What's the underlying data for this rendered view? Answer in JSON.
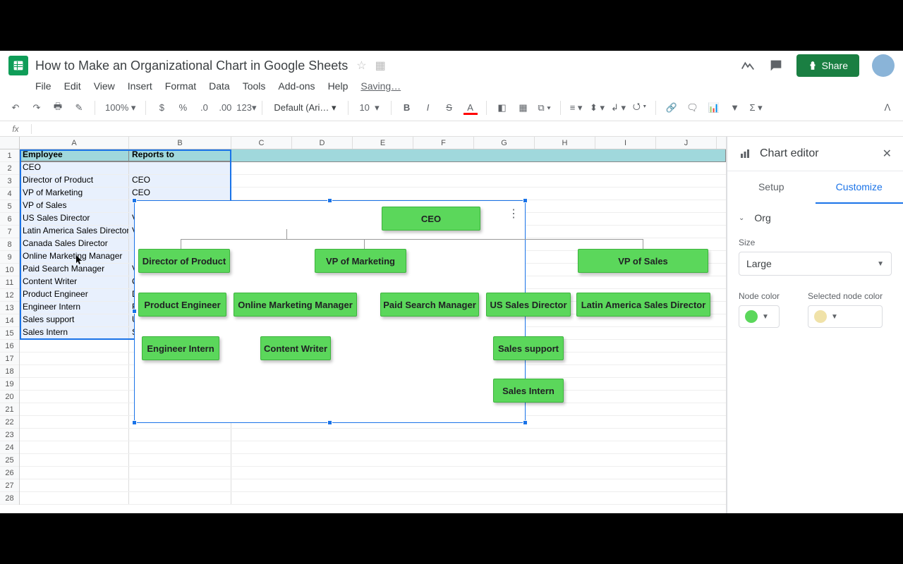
{
  "doc": {
    "title": "How to Make an Organizational Chart in Google Sheets",
    "saving": "Saving…"
  },
  "menus": [
    "File",
    "Edit",
    "View",
    "Insert",
    "Format",
    "Data",
    "Tools",
    "Add-ons",
    "Help"
  ],
  "share": "Share",
  "toolbar": {
    "zoom": "100%",
    "font": "Default (Ari…",
    "size": "10",
    "fmt123": "123"
  },
  "columns": [
    "A",
    "B",
    "C",
    "D",
    "E",
    "F",
    "G",
    "H",
    "I",
    "J"
  ],
  "rowcount": 28,
  "headers": {
    "a": "Employee",
    "b": "Reports to"
  },
  "rows": [
    {
      "a": "CEO",
      "b": ""
    },
    {
      "a": "Director of Product",
      "b": "CEO"
    },
    {
      "a": "VP of Marketing",
      "b": "CEO"
    },
    {
      "a": "VP of Sales",
      "b": ""
    },
    {
      "a": "US Sales Director",
      "b": "V"
    },
    {
      "a": "Latin America Sales Director",
      "b": "V"
    },
    {
      "a": "Canada Sales Director",
      "b": ""
    },
    {
      "a": "Online Marketing Manager",
      "b": ""
    },
    {
      "a": "Paid Search Manager",
      "b": "V"
    },
    {
      "a": "Content Writer",
      "b": "C"
    },
    {
      "a": "Product Engineer",
      "b": "D"
    },
    {
      "a": "Engineer Intern",
      "b": "F"
    },
    {
      "a": "Sales support",
      "b": "U"
    },
    {
      "a": "Sales Intern",
      "b": "S"
    }
  ],
  "chart_data": {
    "type": "org",
    "nodes": [
      {
        "id": "CEO",
        "label": "CEO",
        "parent": null
      },
      {
        "id": "Director of Product",
        "label": "Director of Product",
        "parent": "CEO"
      },
      {
        "id": "VP of Marketing",
        "label": "VP of Marketing",
        "parent": "CEO"
      },
      {
        "id": "VP of Sales",
        "label": "VP of Sales",
        "parent": "CEO"
      },
      {
        "id": "Product Engineer",
        "label": "Product Engineer",
        "parent": "Director of Product"
      },
      {
        "id": "Online Marketing Manager",
        "label": "Online Marketing Manager",
        "parent": "VP of Marketing"
      },
      {
        "id": "Paid Search Manager",
        "label": "Paid Search Manager",
        "parent": "VP of Marketing"
      },
      {
        "id": "US Sales Director",
        "label": "US Sales Director",
        "parent": "VP of Sales"
      },
      {
        "id": "Latin America Sales Director",
        "label": "Latin America Sales Director",
        "parent": "VP of Sales"
      },
      {
        "id": "Engineer Intern",
        "label": "Engineer Intern",
        "parent": "Product Engineer"
      },
      {
        "id": "Content Writer",
        "label": "Content Writer",
        "parent": "Online Marketing Manager"
      },
      {
        "id": "Sales support",
        "label": "Sales support",
        "parent": "US Sales Director"
      },
      {
        "id": "Sales Intern",
        "label": "Sales Intern",
        "parent": "Sales support"
      }
    ],
    "node_color": "#5bd75b",
    "selected_node_color": "#f0e2a8"
  },
  "editor": {
    "title": "Chart editor",
    "tabs": {
      "setup": "Setup",
      "customize": "Customize"
    },
    "section": "Org",
    "size_label": "Size",
    "size_value": "Large",
    "node_color_label": "Node color",
    "sel_color_label": "Selected node color"
  }
}
